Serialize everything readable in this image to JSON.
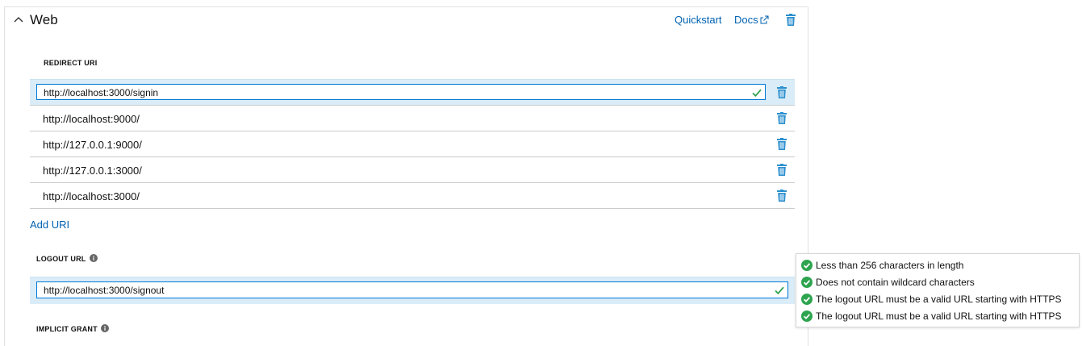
{
  "section": {
    "title": "Web",
    "quickstart": "Quickstart",
    "docs": "Docs"
  },
  "redirect": {
    "label": "REDIRECT URI",
    "active_value": "http://localhost:3000/signin",
    "uris": [
      "http://localhost:9000/",
      "http://127.0.0.1:9000/",
      "http://127.0.0.1:3000/",
      "http://localhost:3000/"
    ],
    "add_label": "Add URI"
  },
  "logout": {
    "label": "LOGOUT URL",
    "value": "http://localhost:3000/signout"
  },
  "implicit": {
    "label": "IMPLICIT GRANT"
  },
  "validation": [
    "Less than 256 characters in length",
    "Does not contain wildcard characters",
    "The logout URL must be a valid URL starting with HTTPS",
    "The logout URL must be a valid URL starting with HTTPS"
  ],
  "colors": {
    "link": "#0062b1",
    "trash": "#2b8fcf",
    "success": "#2ea44f",
    "active_row": "#d9ecf8"
  },
  "icons": {
    "collapse": "chevron-up-icon",
    "external": "external-link-icon",
    "delete": "trash-icon",
    "valid": "checkmark-icon",
    "info": "info-icon",
    "success": "check-circle-icon"
  }
}
